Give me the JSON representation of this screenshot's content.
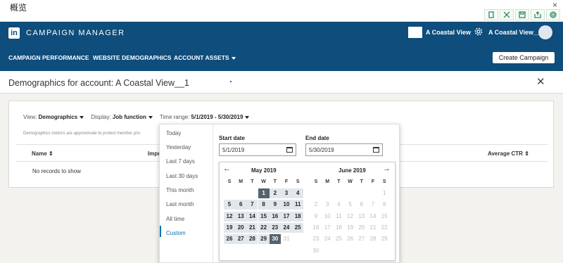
{
  "window": {
    "title": "概览",
    "close": "×"
  },
  "toolbar_icons": [
    "file-icon",
    "expand-icon",
    "save-icon",
    "export-icon",
    "settings-icon"
  ],
  "header": {
    "logo": "in",
    "brand": "CAMPAIGN MANAGER",
    "account_name": "A Coastal View",
    "account_name_2": "A Coastal View__1",
    "nav": [
      "CAMPAIGN PERFORMANCE",
      "WEBSITE DEMOGRAPHICS",
      "ACCOUNT ASSETS"
    ],
    "create_button": "Create Campaign"
  },
  "page": {
    "title": "Demographics for account: A Coastal View__1",
    "close": "✕"
  },
  "filters": {
    "view_label": "View:",
    "view_value": "Demographics",
    "display_label": "Display:",
    "display_value": "Job function",
    "time_label": "Time range:",
    "time_value": "5/1/2019 - 5/30/2019"
  },
  "note": "Demographics metrics are approximate to protect member priv",
  "table": {
    "columns": [
      "Name",
      "Impr",
      "Average CTR"
    ],
    "empty": "No records to show"
  },
  "range_options": [
    "Today",
    "Yesterday",
    "Last 7 days",
    "Last 30 days",
    "This month",
    "Last month",
    "All time",
    "Custom"
  ],
  "range_selected": "Custom",
  "start_date": {
    "label": "Start date",
    "value": "5/1/2019"
  },
  "end_date": {
    "label": "End date",
    "value": "5/30/2019"
  },
  "calendar": {
    "prev": "←",
    "next": "→",
    "weekdays": [
      "S",
      "M",
      "T",
      "W",
      "T",
      "F",
      "S"
    ],
    "months": [
      {
        "name": "May 2019",
        "first_weekday": 3,
        "days": 31,
        "selected_start": 1,
        "selected_end": 30
      },
      {
        "name": "June 2019",
        "first_weekday": 6,
        "days": 30
      }
    ]
  },
  "colors": {
    "header": "#0e4d7c",
    "accent": "#0073b1",
    "selected": "#55636e",
    "range": "#e2e7ec"
  }
}
